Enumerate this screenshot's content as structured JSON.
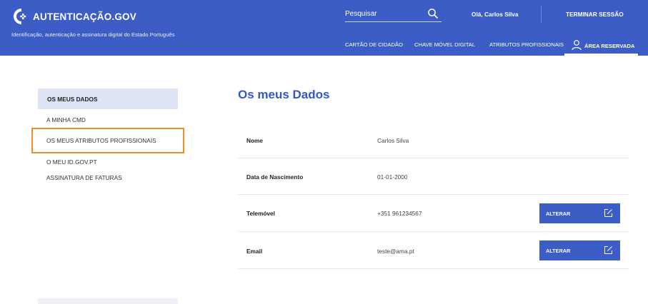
{
  "header": {
    "brand": "AUTENTICAÇÃO.GOV",
    "tagline": "Identificação, autenticação e assinatura digital do Estado Português",
    "search_placeholder": "Pesquisar",
    "greeting": "Olá, Carlos Silva",
    "logout_label": "TERMINAR SESSÃO",
    "nav": [
      {
        "label": "CARTÃO DE CIDADÃO"
      },
      {
        "label": "CHAVE MÓVEL DIGITAL"
      },
      {
        "label": "ATRIBUTOS PROFISSIONAIS"
      }
    ],
    "active_nav_label": "ÁREA RESERVADA"
  },
  "sidebar": {
    "active_label": "OS MEUS DADOS",
    "items": [
      {
        "label": "A MINHA CMD"
      },
      {
        "label": "OS MEUS ATRIBUTOS PROFISSIONAIS"
      },
      {
        "label": "O MEU ID.GOV.PT"
      },
      {
        "label": "ASSINATURA DE FATURAS"
      }
    ]
  },
  "main": {
    "title": "Os meus Dados",
    "rows": [
      {
        "label": "Nome",
        "value": "Carlos Silva"
      },
      {
        "label": "Data de Nascimento",
        "value": "01-01-2000"
      },
      {
        "label": "Telemóvel",
        "value": "+351 961234567",
        "action": "ALTERAR"
      },
      {
        "label": "Email",
        "value": "teste@ama.pt",
        "action": "ALTERAR"
      }
    ]
  },
  "colors": {
    "brand_blue": "#3c5dc6",
    "title_blue": "#3457c4",
    "highlight_orange": "#f28c2b",
    "sidebar_active_bg": "#dfe4f5"
  },
  "icons": [
    "logo-icon",
    "search-icon",
    "user-icon",
    "edit-icon"
  ]
}
